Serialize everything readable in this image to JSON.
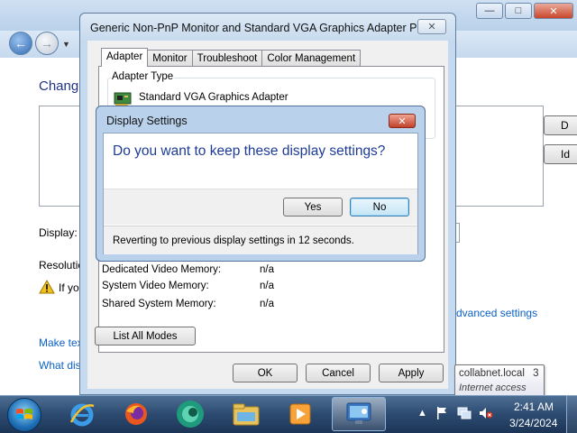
{
  "background_window": {
    "heading_fragment": "Change",
    "side_button_1": "D",
    "side_button_2": "Id",
    "display_label": "Display:",
    "resolution_label": "Resolutio",
    "warning_fragment": "If yo",
    "advanced_settings_link": "Advanced settings",
    "link_make_text": "Make tex",
    "link_what_display": "What dis"
  },
  "properties_dialog": {
    "title": "Generic Non-PnP Monitor and Standard VGA Graphics Adapter Pro...",
    "tabs": [
      {
        "label": "Adapter"
      },
      {
        "label": "Monitor"
      },
      {
        "label": "Troubleshoot"
      },
      {
        "label": "Color Management"
      }
    ],
    "adapter_type_label": "Adapter Type",
    "adapter_name": "Standard VGA Graphics Adapter",
    "memory": [
      {
        "label": "Dedicated Video Memory:",
        "value": "n/a"
      },
      {
        "label": "System Video Memory:",
        "value": "n/a"
      },
      {
        "label": "Shared System Memory:",
        "value": "n/a"
      }
    ],
    "list_all_modes_button": "List All Modes",
    "ok_button": "OK",
    "cancel_button": "Cancel",
    "apply_button": "Apply"
  },
  "display_settings_dialog": {
    "title": "Display Settings",
    "question": "Do you want to keep these display settings?",
    "yes_button": "Yes",
    "no_button": "No",
    "status": "Reverting to previous display settings in 12 seconds."
  },
  "tooltip": {
    "network_name": "collabnet.local",
    "network_count": "3",
    "access": "Internet access"
  },
  "taskbar": {
    "pinned": [
      {
        "icon": "internet-explorer-icon"
      },
      {
        "icon": "firefox-icon"
      },
      {
        "icon": "app-green-icon"
      },
      {
        "icon": "file-explorer-icon"
      },
      {
        "icon": "media-player-icon"
      },
      {
        "icon": "control-panel-icon"
      }
    ],
    "clock_time": "2:41 AM",
    "clock_date": "3/24/2024"
  },
  "colors": {
    "title_blue": "#1e3c94",
    "link_blue": "#0b61c8",
    "taskbar": "#2c4a70",
    "close_red": "#c0412a"
  }
}
